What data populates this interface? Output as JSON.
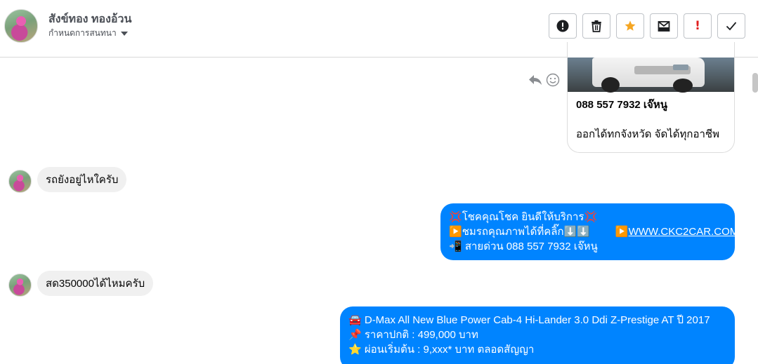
{
  "header": {
    "contact_name": "สังข์ทอง ทองอ้วน",
    "manage_chat_label": "กำหนดการสนทนา",
    "toolbar": [
      {
        "icon": "alert-circle-icon",
        "name": "mark-spam-button"
      },
      {
        "icon": "trash-icon",
        "name": "delete-button"
      },
      {
        "icon": "star-icon",
        "name": "star-button"
      },
      {
        "icon": "archive-icon",
        "name": "archive-button"
      },
      {
        "icon": "exclamation-icon",
        "name": "priority-button",
        "text": "!"
      },
      {
        "icon": "check-icon",
        "name": "done-button"
      }
    ]
  },
  "colors": {
    "outgoing_bubble": "#0084ff",
    "incoming_bubble": "#f0f0f0",
    "star": "#f5a623",
    "priority": "#e02020"
  },
  "card": {
    "phone": "088 557 7932 เจ๊หนู",
    "description": "ออกได้ทกจังหวัด จัดได้ทุกอาชีพ"
  },
  "messages": [
    {
      "direction": "in",
      "text": "รถยังอยู่ไหใครับ"
    },
    {
      "direction": "out",
      "lines": [
        {
          "emoji": "💢",
          "text": "โชคคุณโชค ยินดีให้บริการ",
          "emoji_end": "💢"
        },
        {
          "emoji": "▶️",
          "text": "ชมรถคุณภาพได้ที่คลิ๊ก⬇️⬇️",
          "emoji2": "▶️",
          "link": "WWW.CKC2CAR.COM"
        },
        {
          "emoji": "📲",
          "text": " สายด่วน 088 557 7932 เจ๊หนู"
        }
      ]
    },
    {
      "direction": "in",
      "text": "สด350000ได้ไหมครับ"
    },
    {
      "direction": "out",
      "lines": [
        {
          "emoji": "🚘",
          "text": " D-Max All New Blue Power Cab-4 Hi-Lander 3.0 Ddi Z-Prestige AT ปี 2017"
        },
        {
          "emoji": "📌",
          "text": " ราคาปกติ : 499,000 บาท"
        },
        {
          "emoji": "⭐",
          "text": " ผ่อนเริ่มต้น : 9,xxx* บาท ตลอดสัญญา"
        }
      ]
    }
  ]
}
